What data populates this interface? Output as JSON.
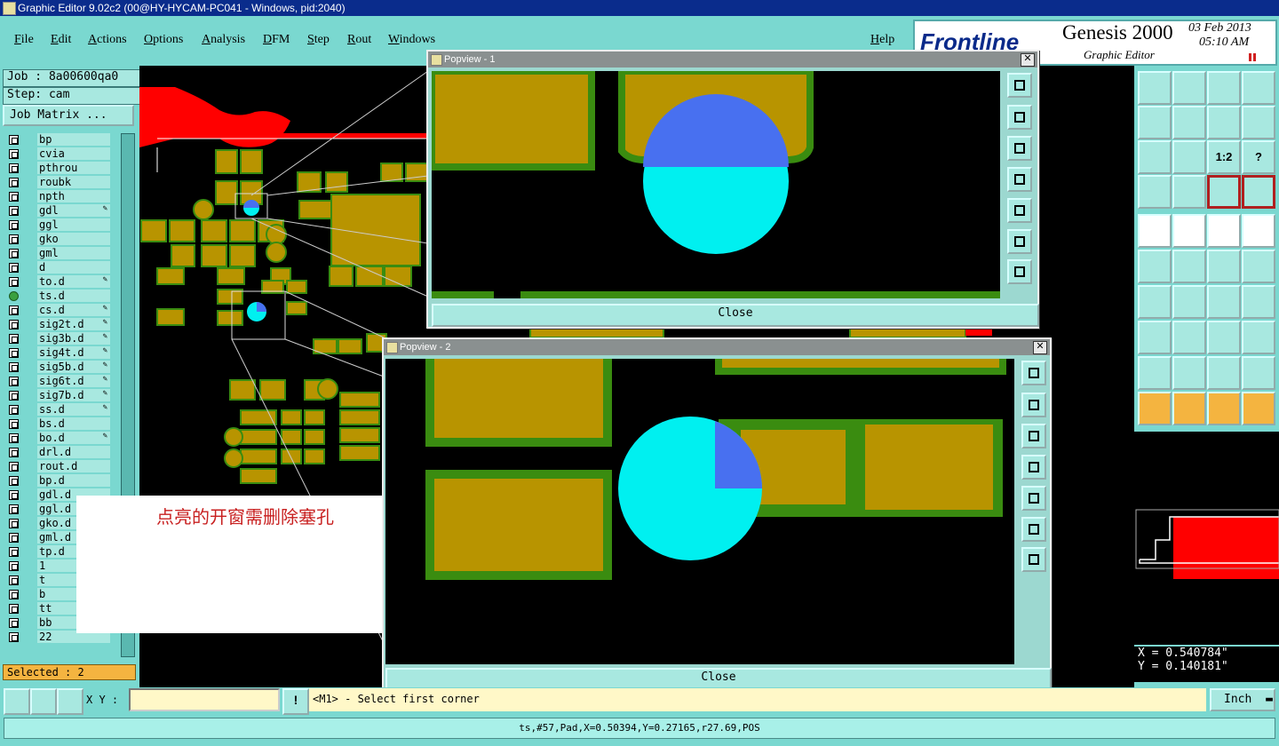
{
  "window": {
    "title": "Graphic Editor 9.02c2 (00@HY-HYCAM-PC041 - Windows, pid:2040)"
  },
  "menu": [
    "File",
    "Edit",
    "Actions",
    "Options",
    "Analysis",
    "DFM",
    "Step",
    "Rout",
    "Windows"
  ],
  "help_label": "Help",
  "brand": {
    "logo": "Frontline",
    "product": "Genesis 2000",
    "date": "03 Feb 2013",
    "time": "05:10 AM",
    "subtitle": "Graphic Editor"
  },
  "job": {
    "job_label": "Job : 8a00600qa0",
    "step_label": "Step: cam",
    "matrix_button": "Job Matrix ..."
  },
  "layers": [
    {
      "name": "bp",
      "mark": ""
    },
    {
      "name": "cvia",
      "mark": ""
    },
    {
      "name": "pthrou",
      "mark": ""
    },
    {
      "name": "roubk",
      "mark": ""
    },
    {
      "name": "npth",
      "mark": ""
    },
    {
      "name": "gdl",
      "mark": "✎"
    },
    {
      "name": "ggl",
      "mark": ""
    },
    {
      "name": "gko",
      "mark": ""
    },
    {
      "name": "gml",
      "mark": ""
    },
    {
      "name": "d",
      "mark": ""
    },
    {
      "name": "to.d",
      "mark": "✎"
    },
    {
      "name": "ts.d",
      "mark": "",
      "on": true
    },
    {
      "name": "cs.d",
      "mark": "✎"
    },
    {
      "name": "sig2t.d",
      "mark": "✎"
    },
    {
      "name": "sig3b.d",
      "mark": "✎"
    },
    {
      "name": "sig4t.d",
      "mark": "✎"
    },
    {
      "name": "sig5b.d",
      "mark": "✎"
    },
    {
      "name": "sig6t.d",
      "mark": "✎"
    },
    {
      "name": "sig7b.d",
      "mark": "✎"
    },
    {
      "name": "ss.d",
      "mark": "✎"
    },
    {
      "name": "bs.d",
      "mark": ""
    },
    {
      "name": "bo.d",
      "mark": "✎"
    },
    {
      "name": "drl.d",
      "mark": ""
    },
    {
      "name": "rout.d",
      "mark": ""
    },
    {
      "name": "bp.d",
      "mark": ""
    },
    {
      "name": "gdl.d",
      "mark": ""
    },
    {
      "name": "ggl.d",
      "mark": ""
    },
    {
      "name": "gko.d",
      "mark": ""
    },
    {
      "name": "gml.d",
      "mark": ""
    },
    {
      "name": "tp.d",
      "mark": ""
    },
    {
      "name": "1",
      "mark": ""
    },
    {
      "name": "t",
      "mark": ""
    },
    {
      "name": "b",
      "mark": ""
    },
    {
      "name": "tt",
      "mark": ""
    },
    {
      "name": "bb",
      "mark": ""
    },
    {
      "name": "22",
      "mark": ""
    }
  ],
  "selected_label": "Selected : 2",
  "popview1": {
    "title": "Popview - 1",
    "close_label": "Close"
  },
  "popview2": {
    "title": "Popview - 2",
    "close_label": "Close"
  },
  "annotation": "点亮的开窗需删除塞孔",
  "coords": {
    "x": "X = 0.540784\"",
    "y": "Y = 0.140181\""
  },
  "bottom": {
    "xy_label": "X Y :",
    "prompt": "<M1> - Select first corner",
    "units": "Inch",
    "status": "ts,#57,Pad,X=0.50394,Y=0.27165,r27.69,POS"
  },
  "toolbar_text": {
    "scale": "1:2",
    "help": "?"
  },
  "colors": {
    "pad": "#b89400",
    "mask": "#3a8c10",
    "highlight": "#00f0f0",
    "selection": "#4870f0",
    "copper": "#ff0000"
  }
}
